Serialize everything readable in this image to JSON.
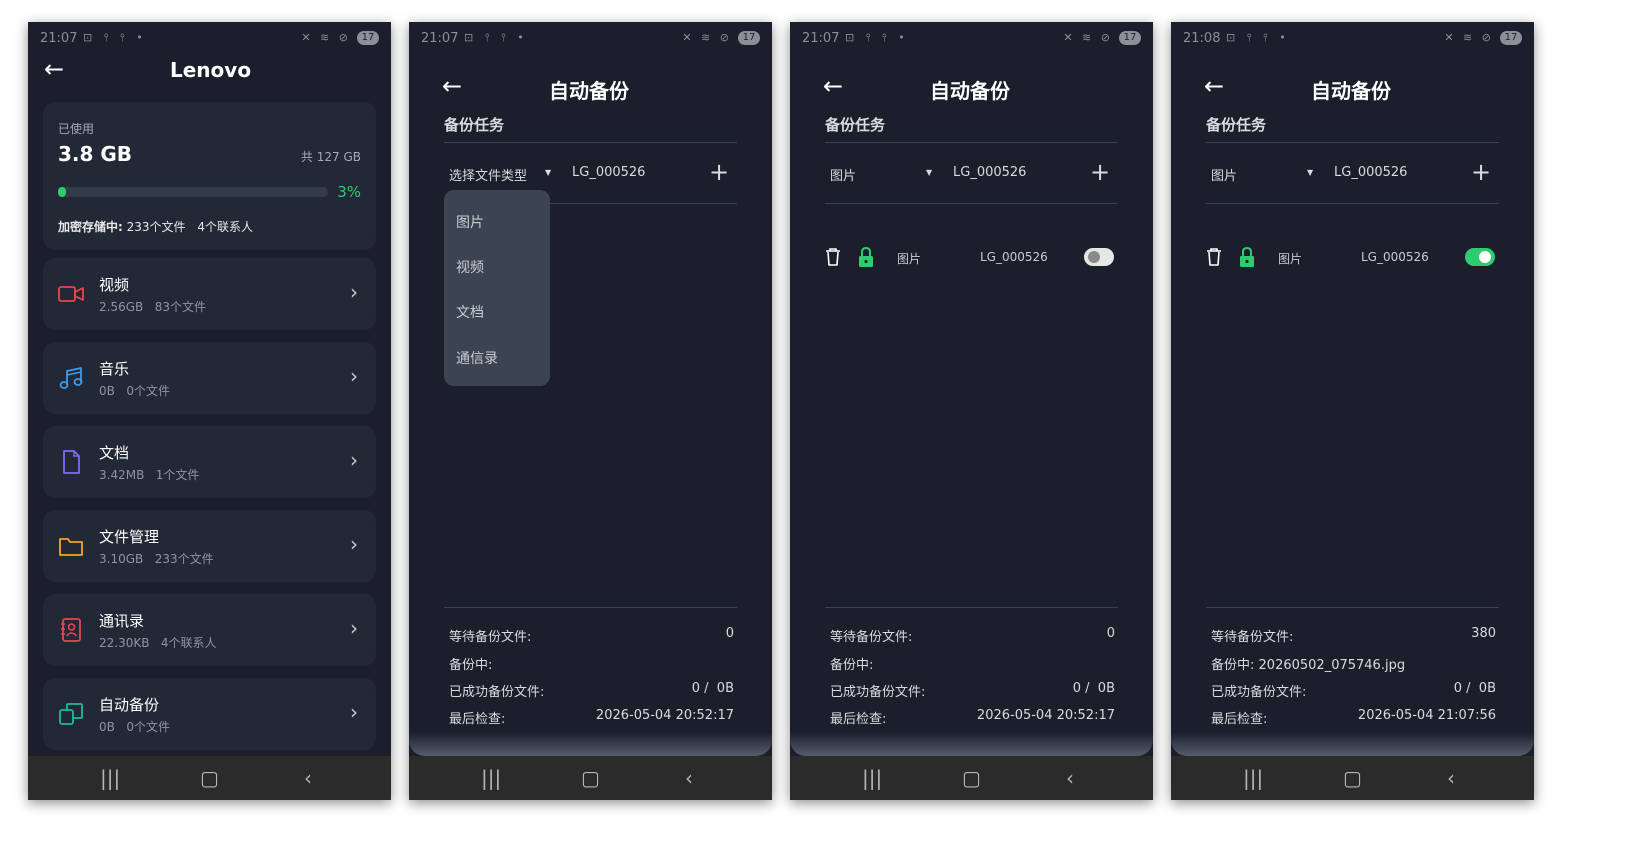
{
  "colors": {
    "accent_green": "#2ecc71",
    "screen_bg": "#1a1f2b",
    "card_bg": "#222836"
  },
  "phone1": {
    "status_time": "21:07",
    "battery": "17",
    "title": "Lenovo",
    "storage": {
      "used_label": "已使用",
      "used_value": "3.8 GB",
      "total": "共 127 GB",
      "percent": "3%",
      "percent_value": 3,
      "encrypted_label": "加密存储中:",
      "encrypted_files": "233个文件",
      "encrypted_contacts": "4个联系人"
    },
    "categories": [
      {
        "name": "视频",
        "size": "2.56GB",
        "count": "83个文件",
        "icon": "video-icon"
      },
      {
        "name": "音乐",
        "size": "0B",
        "count": "0个文件",
        "icon": "music-icon"
      },
      {
        "name": "文档",
        "size": "3.42MB",
        "count": "1个文件",
        "icon": "document-icon"
      },
      {
        "name": "文件管理",
        "size": "3.10GB",
        "count": "233个文件",
        "icon": "folder-icon"
      },
      {
        "name": "通讯录",
        "size": "22.30KB",
        "count": "4个联系人",
        "icon": "contacts-icon"
      },
      {
        "name": "自动备份",
        "size": "0B",
        "count": "0个文件",
        "icon": "backup-icon"
      }
    ]
  },
  "backup_common": {
    "title": "自动备份",
    "section": "备份任务",
    "device": "LG_000526",
    "waiting_label": "等待备份文件:",
    "backing_label": "备份中:",
    "success_label": "已成功备份文件:",
    "last_check_label": "最后检查:"
  },
  "phone2": {
    "status_time": "21:07",
    "battery": "17",
    "type_select": "选择文件类型",
    "dropdown": [
      "图片",
      "视频",
      "文档",
      "通信录"
    ],
    "waiting": "0",
    "backing": "",
    "success": "0 /  0B",
    "last_check": "2026-05-04 20:52:17"
  },
  "phone3": {
    "status_time": "21:07",
    "battery": "17",
    "type_select": "图片",
    "task_type": "图片",
    "task_enabled": false,
    "waiting": "0",
    "backing": "",
    "success": "0 /  0B",
    "last_check": "2026-05-04 20:52:17"
  },
  "phone4": {
    "status_time": "21:08",
    "battery": "17",
    "type_select": "图片",
    "task_type": "图片",
    "task_enabled": true,
    "waiting": "380",
    "backing": "20260502_075746.jpg",
    "success": "0 /  0B",
    "last_check": "2026-05-04 21:07:56"
  }
}
